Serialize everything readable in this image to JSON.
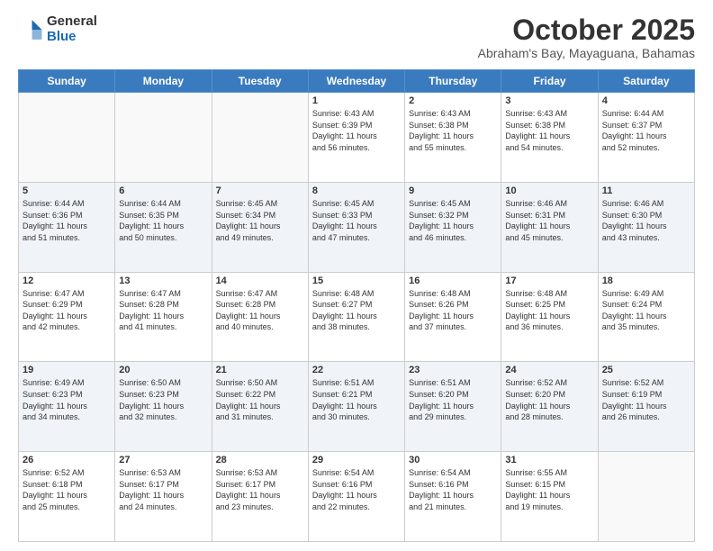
{
  "logo": {
    "general": "General",
    "blue": "Blue"
  },
  "title": "October 2025",
  "subtitle": "Abraham's Bay, Mayaguana, Bahamas",
  "weekdays": [
    "Sunday",
    "Monday",
    "Tuesday",
    "Wednesday",
    "Thursday",
    "Friday",
    "Saturday"
  ],
  "weeks": [
    [
      {
        "day": "",
        "info": ""
      },
      {
        "day": "",
        "info": ""
      },
      {
        "day": "",
        "info": ""
      },
      {
        "day": "1",
        "info": "Sunrise: 6:43 AM\nSunset: 6:39 PM\nDaylight: 11 hours\nand 56 minutes."
      },
      {
        "day": "2",
        "info": "Sunrise: 6:43 AM\nSunset: 6:38 PM\nDaylight: 11 hours\nand 55 minutes."
      },
      {
        "day": "3",
        "info": "Sunrise: 6:43 AM\nSunset: 6:38 PM\nDaylight: 11 hours\nand 54 minutes."
      },
      {
        "day": "4",
        "info": "Sunrise: 6:44 AM\nSunset: 6:37 PM\nDaylight: 11 hours\nand 52 minutes."
      }
    ],
    [
      {
        "day": "5",
        "info": "Sunrise: 6:44 AM\nSunset: 6:36 PM\nDaylight: 11 hours\nand 51 minutes."
      },
      {
        "day": "6",
        "info": "Sunrise: 6:44 AM\nSunset: 6:35 PM\nDaylight: 11 hours\nand 50 minutes."
      },
      {
        "day": "7",
        "info": "Sunrise: 6:45 AM\nSunset: 6:34 PM\nDaylight: 11 hours\nand 49 minutes."
      },
      {
        "day": "8",
        "info": "Sunrise: 6:45 AM\nSunset: 6:33 PM\nDaylight: 11 hours\nand 47 minutes."
      },
      {
        "day": "9",
        "info": "Sunrise: 6:45 AM\nSunset: 6:32 PM\nDaylight: 11 hours\nand 46 minutes."
      },
      {
        "day": "10",
        "info": "Sunrise: 6:46 AM\nSunset: 6:31 PM\nDaylight: 11 hours\nand 45 minutes."
      },
      {
        "day": "11",
        "info": "Sunrise: 6:46 AM\nSunset: 6:30 PM\nDaylight: 11 hours\nand 43 minutes."
      }
    ],
    [
      {
        "day": "12",
        "info": "Sunrise: 6:47 AM\nSunset: 6:29 PM\nDaylight: 11 hours\nand 42 minutes."
      },
      {
        "day": "13",
        "info": "Sunrise: 6:47 AM\nSunset: 6:28 PM\nDaylight: 11 hours\nand 41 minutes."
      },
      {
        "day": "14",
        "info": "Sunrise: 6:47 AM\nSunset: 6:28 PM\nDaylight: 11 hours\nand 40 minutes."
      },
      {
        "day": "15",
        "info": "Sunrise: 6:48 AM\nSunset: 6:27 PM\nDaylight: 11 hours\nand 38 minutes."
      },
      {
        "day": "16",
        "info": "Sunrise: 6:48 AM\nSunset: 6:26 PM\nDaylight: 11 hours\nand 37 minutes."
      },
      {
        "day": "17",
        "info": "Sunrise: 6:48 AM\nSunset: 6:25 PM\nDaylight: 11 hours\nand 36 minutes."
      },
      {
        "day": "18",
        "info": "Sunrise: 6:49 AM\nSunset: 6:24 PM\nDaylight: 11 hours\nand 35 minutes."
      }
    ],
    [
      {
        "day": "19",
        "info": "Sunrise: 6:49 AM\nSunset: 6:23 PM\nDaylight: 11 hours\nand 34 minutes."
      },
      {
        "day": "20",
        "info": "Sunrise: 6:50 AM\nSunset: 6:23 PM\nDaylight: 11 hours\nand 32 minutes."
      },
      {
        "day": "21",
        "info": "Sunrise: 6:50 AM\nSunset: 6:22 PM\nDaylight: 11 hours\nand 31 minutes."
      },
      {
        "day": "22",
        "info": "Sunrise: 6:51 AM\nSunset: 6:21 PM\nDaylight: 11 hours\nand 30 minutes."
      },
      {
        "day": "23",
        "info": "Sunrise: 6:51 AM\nSunset: 6:20 PM\nDaylight: 11 hours\nand 29 minutes."
      },
      {
        "day": "24",
        "info": "Sunrise: 6:52 AM\nSunset: 6:20 PM\nDaylight: 11 hours\nand 28 minutes."
      },
      {
        "day": "25",
        "info": "Sunrise: 6:52 AM\nSunset: 6:19 PM\nDaylight: 11 hours\nand 26 minutes."
      }
    ],
    [
      {
        "day": "26",
        "info": "Sunrise: 6:52 AM\nSunset: 6:18 PM\nDaylight: 11 hours\nand 25 minutes."
      },
      {
        "day": "27",
        "info": "Sunrise: 6:53 AM\nSunset: 6:17 PM\nDaylight: 11 hours\nand 24 minutes."
      },
      {
        "day": "28",
        "info": "Sunrise: 6:53 AM\nSunset: 6:17 PM\nDaylight: 11 hours\nand 23 minutes."
      },
      {
        "day": "29",
        "info": "Sunrise: 6:54 AM\nSunset: 6:16 PM\nDaylight: 11 hours\nand 22 minutes."
      },
      {
        "day": "30",
        "info": "Sunrise: 6:54 AM\nSunset: 6:16 PM\nDaylight: 11 hours\nand 21 minutes."
      },
      {
        "day": "31",
        "info": "Sunrise: 6:55 AM\nSunset: 6:15 PM\nDaylight: 11 hours\nand 19 minutes."
      },
      {
        "day": "",
        "info": ""
      }
    ]
  ]
}
